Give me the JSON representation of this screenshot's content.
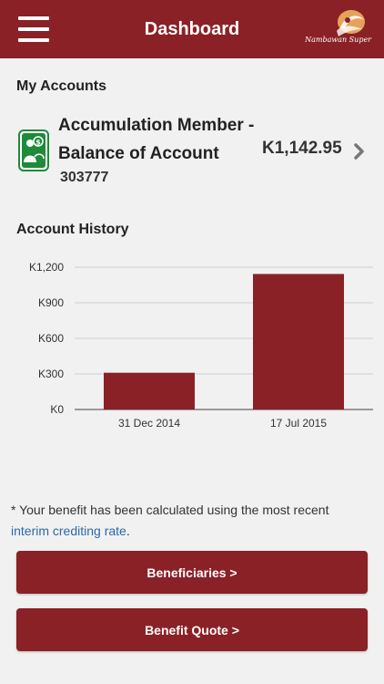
{
  "header": {
    "title": "Dashboard",
    "logo_text": "Nambawan Super",
    "menu_icon": "hamburger-menu-icon",
    "brand_color": "#8a2126"
  },
  "accounts": {
    "section_title": "My Accounts",
    "items": [
      {
        "name": "Accumulation Member - Balance of Account",
        "number": "303777",
        "balance": "K1,142.95",
        "icon": "member-balance-icon"
      }
    ]
  },
  "history": {
    "section_title": "Account History"
  },
  "chart_data": {
    "type": "bar",
    "categories": [
      "31 Dec 2014",
      "17 Jul 2015"
    ],
    "values": [
      310,
      1142.95
    ],
    "ylim": [
      0,
      1200
    ],
    "yticks": [
      0,
      300,
      600,
      900,
      1200
    ],
    "ytick_labels": [
      "K0",
      "K300",
      "K600",
      "K900",
      "K1,200"
    ],
    "grid": true,
    "bar_color": "#8a2126"
  },
  "note": {
    "text": "* Your benefit has been calculated using the most recent",
    "link": "interim crediting rate",
    "suffix": "."
  },
  "buttons": {
    "beneficiaries": "Beneficiaries >",
    "benefit_quote": "Benefit Quote >"
  }
}
